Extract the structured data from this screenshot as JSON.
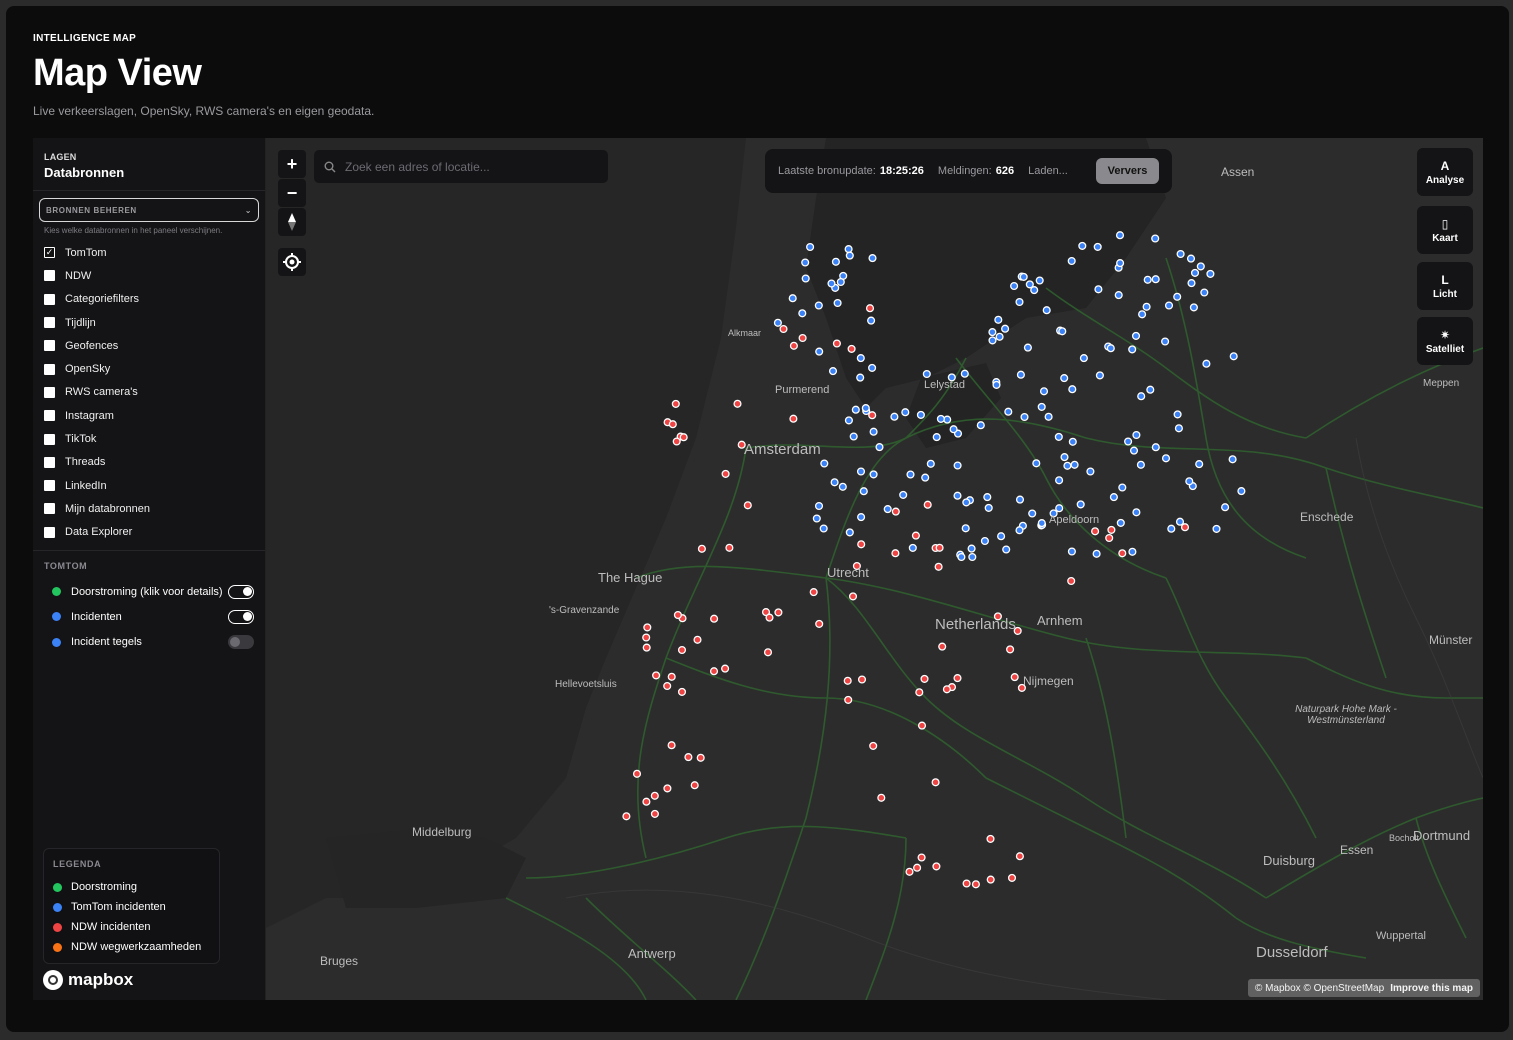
{
  "header": {
    "eyebrow": "INTELLIGENCE MAP",
    "title": "Map View",
    "subtitle": "Live verkeerslagen, OpenSky, RWS camera's en eigen geodata."
  },
  "sidebar": {
    "eyebrow": "LAGEN",
    "title": "Databronnen",
    "select_label": "BRONNEN BEHEREN",
    "select_hint": "Kies welke databronnen in het paneel verschijnen.",
    "sources": [
      {
        "label": "TomTom",
        "checked": true
      },
      {
        "label": "NDW",
        "checked": false
      },
      {
        "label": "Categoriefilters",
        "checked": false
      },
      {
        "label": "Tijdlijn",
        "checked": false
      },
      {
        "label": "Geofences",
        "checked": false
      },
      {
        "label": "OpenSky",
        "checked": false
      },
      {
        "label": "RWS camera's",
        "checked": false
      },
      {
        "label": "Instagram",
        "checked": false
      },
      {
        "label": "TikTok",
        "checked": false
      },
      {
        "label": "Threads",
        "checked": false
      },
      {
        "label": "LinkedIn",
        "checked": false
      },
      {
        "label": "Mijn databronnen",
        "checked": false
      },
      {
        "label": "Data Explorer",
        "checked": false
      }
    ],
    "tomtom_section": "TOMTOM",
    "tomtom_layers": [
      {
        "label": "Doorstroming (klik voor details)",
        "color": "#22c55e",
        "on": true
      },
      {
        "label": "Incidenten",
        "color": "#3b82f6",
        "on": true
      },
      {
        "label": "Incident tegels",
        "color": "#3b82f6",
        "on": false
      }
    ],
    "legend": {
      "title": "LEGENDA",
      "items": [
        {
          "label": "Doorstroming",
          "color": "#22c55e"
        },
        {
          "label": "TomTom incidenten",
          "color": "#3b82f6"
        },
        {
          "label": "NDW incidenten",
          "color": "#ef4444"
        },
        {
          "label": "NDW wegwerkzaamheden",
          "color": "#f97316"
        }
      ]
    },
    "logo": "mapbox"
  },
  "map": {
    "search_placeholder": "Zoek een adres of locatie...",
    "status": {
      "last_update_label": "Laatste bronupdate:",
      "last_update_value": "18:25:26",
      "reports_label": "Meldingen:",
      "reports_value": "626",
      "loading": "Laden...",
      "refresh": "Ververs"
    },
    "side_buttons": [
      {
        "glyph": "A",
        "label": "Analyse"
      },
      {
        "glyph": "▯",
        "label": "Kaart"
      },
      {
        "glyph": "L",
        "label": "Licht"
      },
      {
        "glyph": "✷",
        "label": "Satelliet"
      }
    ],
    "zoom_in": "+",
    "zoom_out": "−",
    "attribution": "© Mapbox © OpenStreetMap",
    "improve": "Improve this map",
    "place_labels": [
      "Assen",
      "Alkmaar",
      "Purmerend",
      "Lelystad",
      "Meppen",
      "Amsterdam",
      "Enschede",
      "The Hague",
      "Utrecht",
      "Apeldoorn",
      "'s-Gravenzande",
      "Netherlands",
      "Arnhem",
      "Münster",
      "Hellevoetsluis",
      "Nijmegen",
      "Naturpark Hohe Mark - Westmünsterland",
      "Middelburg",
      "Bocholt",
      "Dortmund",
      "Duisburg",
      "Essen",
      "Antwerp",
      "Wuppertal",
      "Dusseldorf",
      "Bruges"
    ],
    "colors": {
      "tomtom": "#3b82f6",
      "ndw": "#ef4444",
      "flow": "#2f6b2f"
    }
  }
}
